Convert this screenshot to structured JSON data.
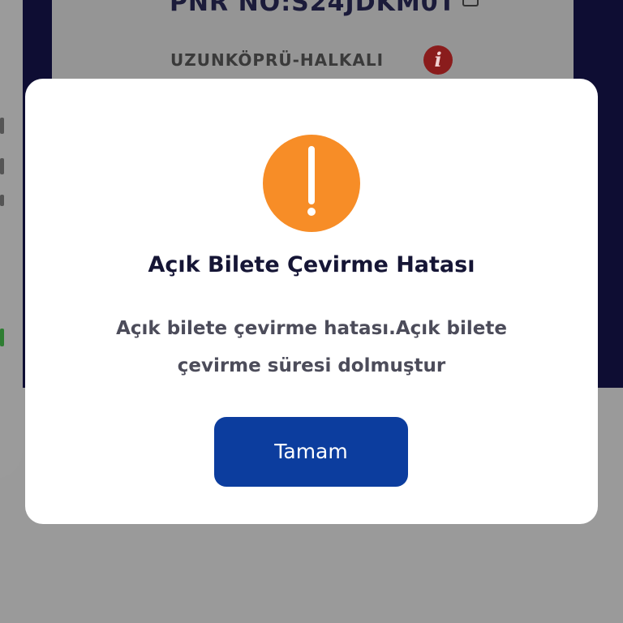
{
  "background": {
    "pnr": "PNR NO:S24JDKM0T",
    "route": "UZUNKÖPRÜ-HALKALI"
  },
  "dialog": {
    "icon": "warning-exclamation-icon",
    "icon_color": "#f78d27",
    "title": "Açık Bilete Çevirme Hatası",
    "message": "Açık bilete çevirme hatası.Açık bilete çevirme süresi dolmuştur",
    "confirm_label": "Tamam",
    "button_color": "#0c3d9e"
  }
}
